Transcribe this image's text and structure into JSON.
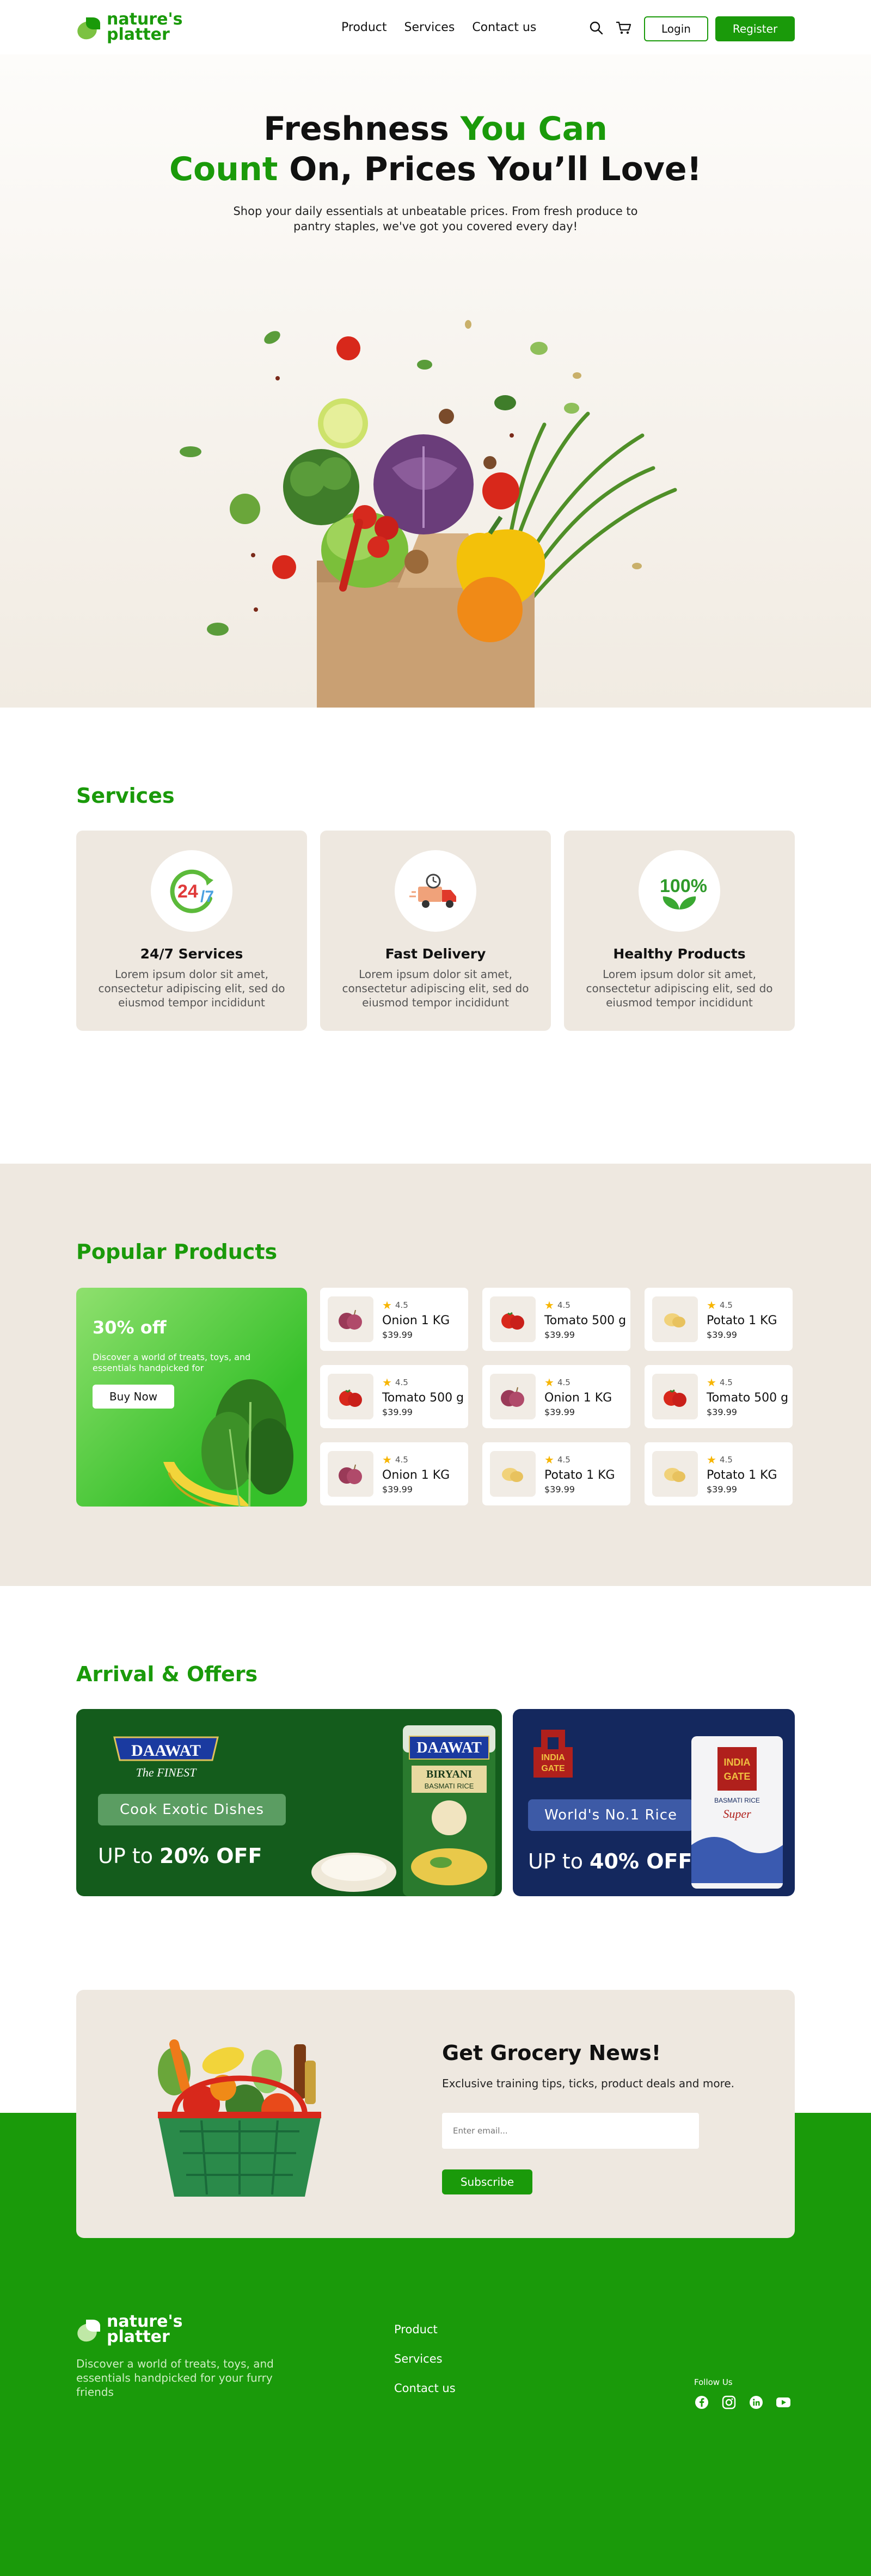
{
  "brand": {
    "line1": "nature's",
    "line2": "platter"
  },
  "nav": [
    "Product",
    "Services",
    "Contact us"
  ],
  "header": {
    "login": "Login",
    "register": "Register"
  },
  "hero": {
    "title_part1": "Freshness ",
    "title_part2": "You Can",
    "title_part3": "Count",
    "title_part4": " On, Prices You’ll Love!",
    "subtitle": "Shop your daily essentials at unbeatable prices. From fresh produce to pantry staples, we've got you covered every day!"
  },
  "services": {
    "title": "Services",
    "items": [
      {
        "title": "24/7 Services",
        "desc": "Lorem ipsum dolor sit amet, consectetur adipiscing elit, sed do eiusmod tempor incididunt",
        "icon": "24-7-icon"
      },
      {
        "title": "Fast Delivery",
        "desc": "Lorem ipsum dolor sit amet, consectetur adipiscing elit, sed do eiusmod tempor incididunt",
        "icon": "delivery-truck-icon"
      },
      {
        "title": "Healthy Products",
        "desc": "Lorem ipsum dolor sit amet, consectetur adipiscing elit, sed do eiusmod tempor incididunt",
        "icon": "100-percent-leaf-icon"
      }
    ]
  },
  "popular": {
    "title": "Popular Products",
    "promo": {
      "title": "30% off",
      "desc": "Discover a world of treats, toys, and essentials handpicked for",
      "button": "Buy Now"
    },
    "products": [
      {
        "name": "Onion 1 KG",
        "rating": "4.5",
        "price": "$39.99",
        "kind": "onion"
      },
      {
        "name": "Tomato 500 g",
        "rating": "4.5",
        "price": "$39.99",
        "kind": "tomato"
      },
      {
        "name": "Potato 1 KG",
        "rating": "4.5",
        "price": "$39.99",
        "kind": "potato"
      },
      {
        "name": "Tomato 500 g",
        "rating": "4.5",
        "price": "$39.99",
        "kind": "tomato"
      },
      {
        "name": "Onion 1 KG",
        "rating": "4.5",
        "price": "$39.99",
        "kind": "onion"
      },
      {
        "name": "Tomato 500 g",
        "rating": "4.5",
        "price": "$39.99",
        "kind": "tomato"
      },
      {
        "name": "Onion 1 KG",
        "rating": "4.5",
        "price": "$39.99",
        "kind": "onion"
      },
      {
        "name": "Potato 1 KG",
        "rating": "4.5",
        "price": "$39.99",
        "kind": "potato"
      },
      {
        "name": "Potato 1 KG",
        "rating": "4.5",
        "price": "$39.99",
        "kind": "potato"
      }
    ]
  },
  "arrival": {
    "title": "Arrival & Offers",
    "offer1": {
      "brand": "DAAWAT",
      "tagline": "The FINEST",
      "pill": "Cook Exotic Dishes",
      "text_prefix": "UP to ",
      "text_bold": "20% OFF",
      "pack_brand": "DAAWAT",
      "pack_line1": "BIRYANI",
      "pack_line2": "BASMATI RICE"
    },
    "offer2": {
      "brand_line1": "INDIA",
      "brand_line2": "GATE",
      "pill": "World's No.1 Rice",
      "text_prefix": "UP to ",
      "text_bold": "40% OFF",
      "pack_line1": "INDIA",
      "pack_line2": "GATE",
      "pack_line3": "BASMATI RICE",
      "pack_line4": "Super"
    }
  },
  "newsletter": {
    "title": "Get Grocery News!",
    "desc": "Exclusive training tips, ticks, product deals and more.",
    "placeholder": "Enter email...",
    "button": "Subscribe"
  },
  "footer": {
    "desc": "Discover a world of treats, toys, and essentials handpicked for your furry friends",
    "links": [
      "Product",
      "Services",
      "Contact us"
    ],
    "follow": "Follow Us",
    "socials": [
      "facebook-icon",
      "instagram-icon",
      "linkedin-icon",
      "youtube-icon"
    ]
  },
  "colors": {
    "brand_green": "#1a9a0a",
    "beige": "#eee8e0",
    "daawat_green": "#145c1c",
    "india_gate_blue": "#14285e",
    "star": "#f7b500"
  }
}
